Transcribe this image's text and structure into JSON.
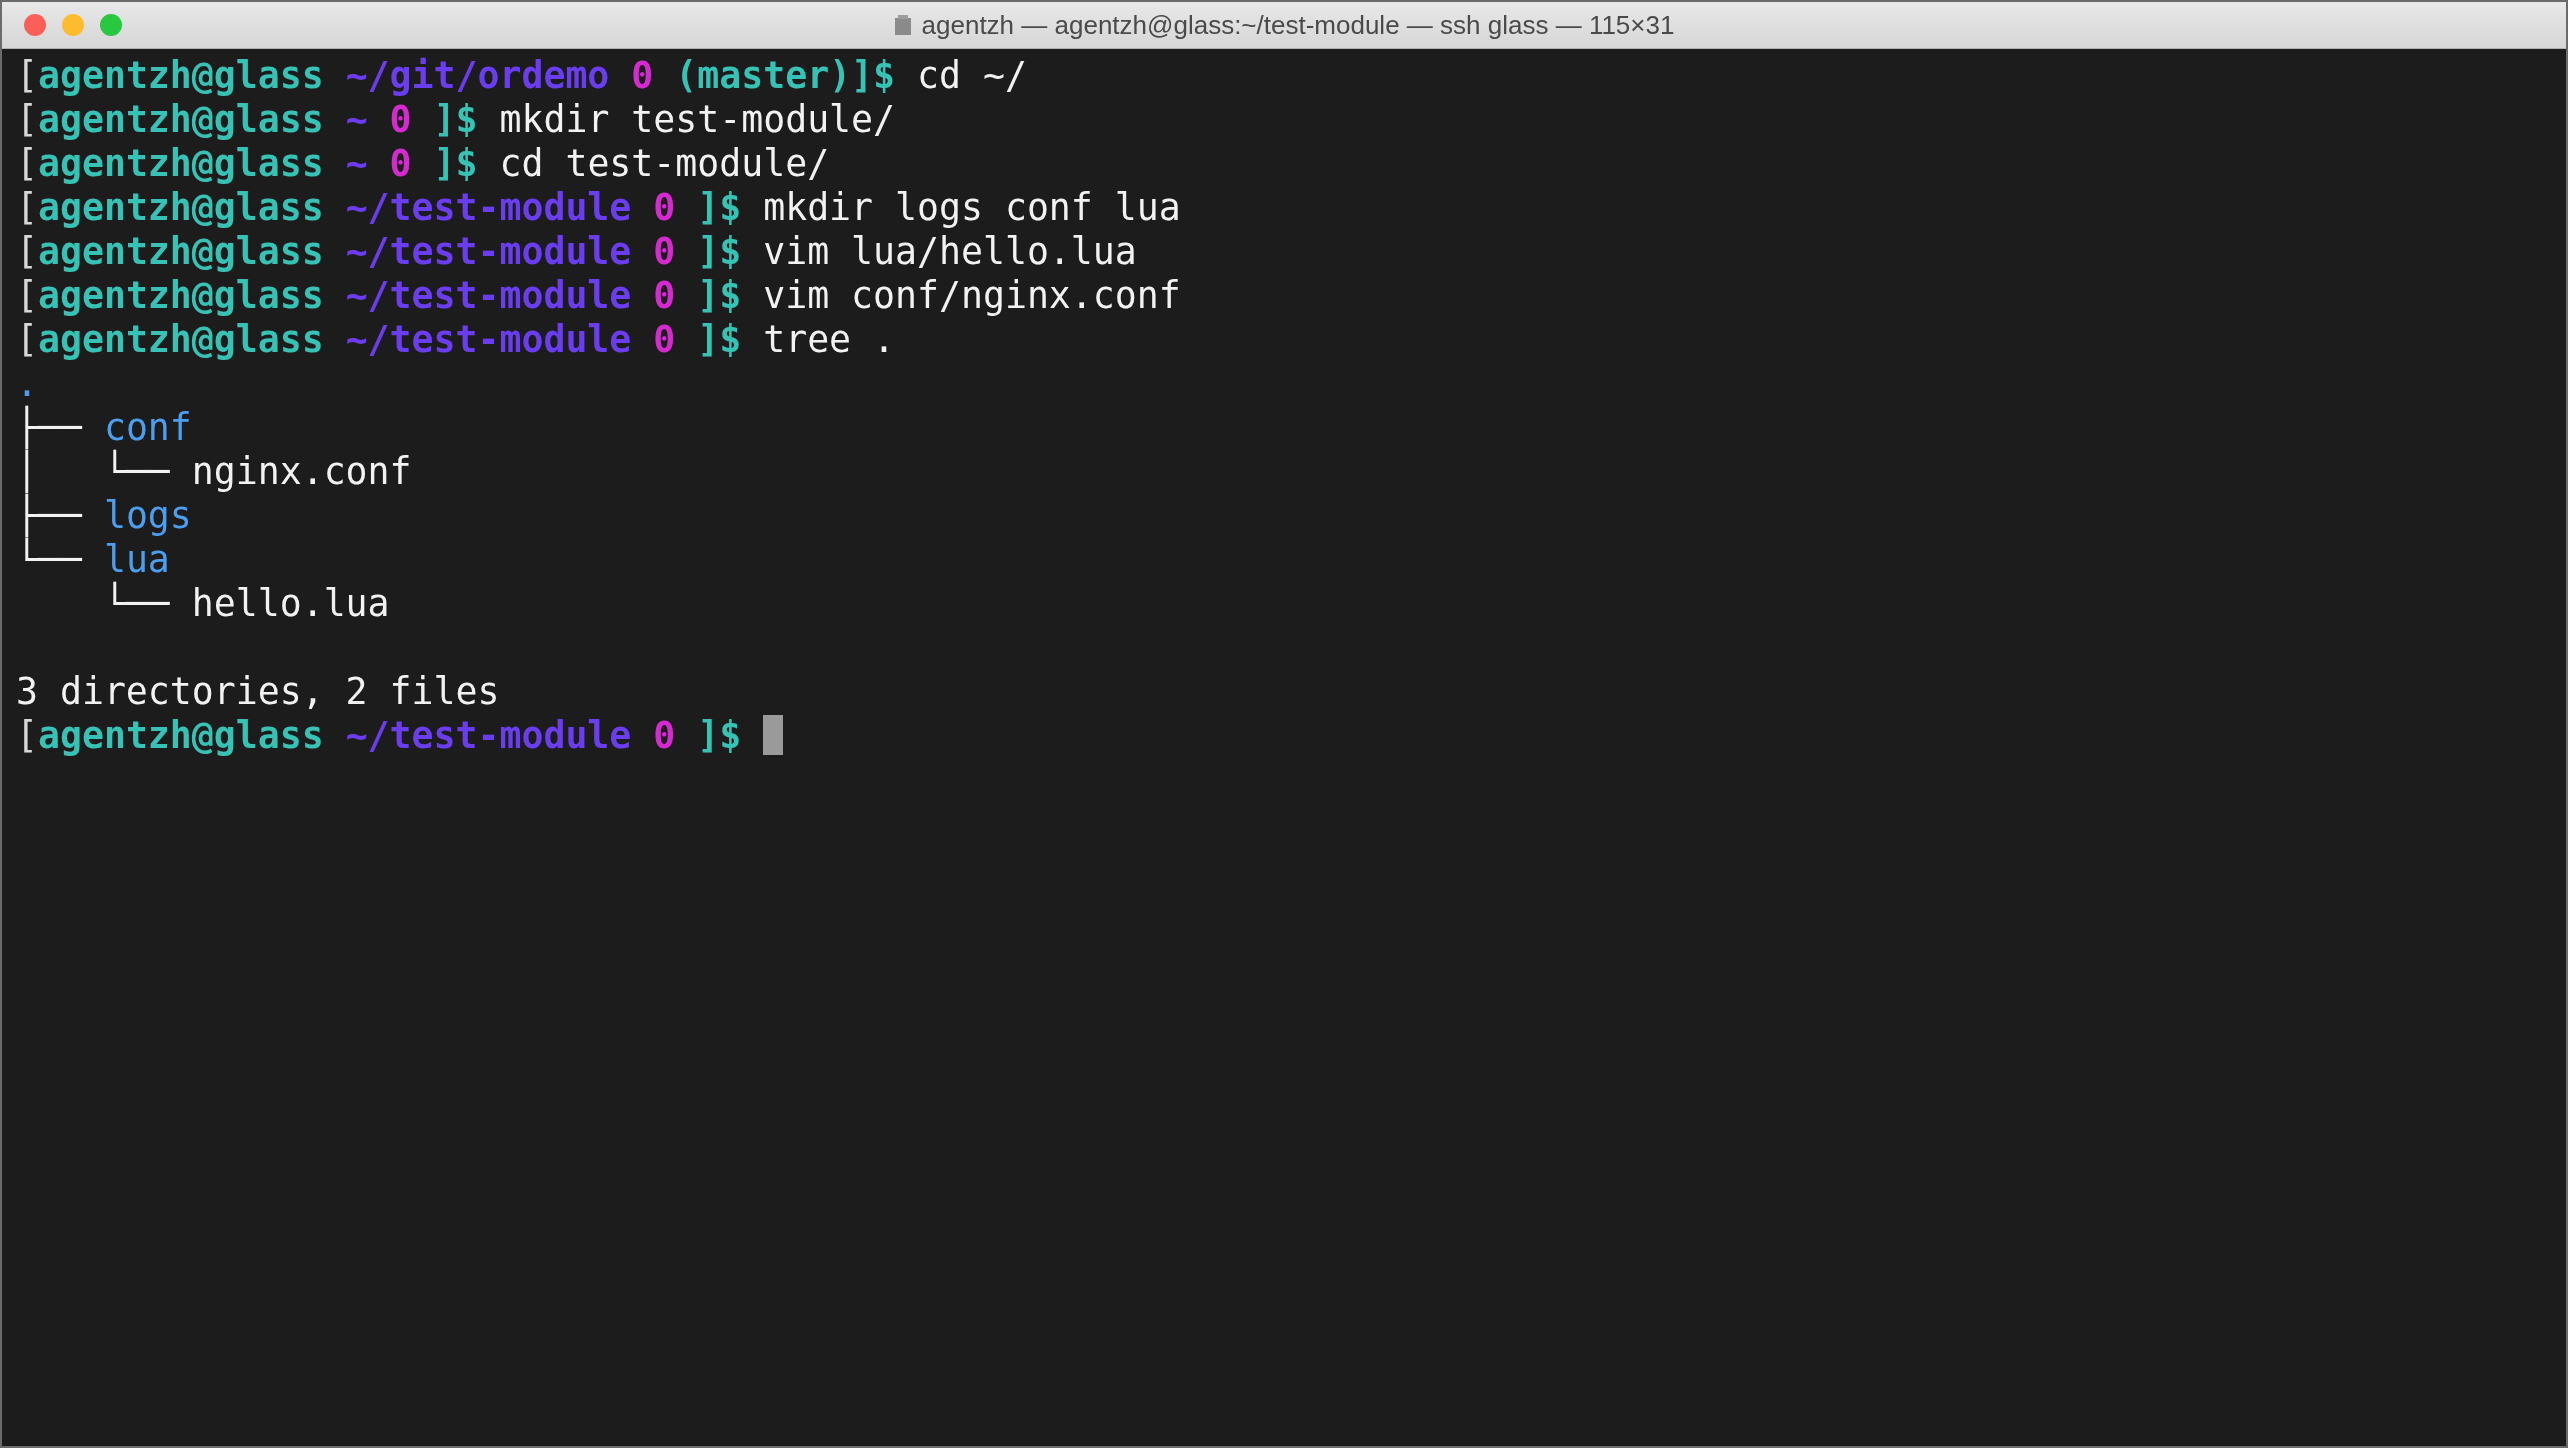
{
  "window": {
    "title": "agentzh — agentzh@glass:~/test-module — ssh glass — 115×31"
  },
  "lines": [
    {
      "kind": "text",
      "segments": [
        {
          "kind": "bracket",
          "text": "["
        },
        {
          "kind": "user",
          "text": "agentzh@glass"
        },
        {
          "kind": "path",
          "text": " ~/git/ordemo"
        },
        {
          "kind": "status",
          "text": " 0"
        },
        {
          "kind": "branch",
          "text": " (master)"
        },
        {
          "kind": "dollar",
          "text": "]$"
        },
        {
          "kind": "command",
          "text": " cd ~/"
        }
      ]
    },
    {
      "kind": "text",
      "segments": [
        {
          "kind": "bracket",
          "text": "["
        },
        {
          "kind": "user",
          "text": "agentzh@glass"
        },
        {
          "kind": "path",
          "text": " ~"
        },
        {
          "kind": "status",
          "text": " 0"
        },
        {
          "kind": "dollar",
          "text": " ]$"
        },
        {
          "kind": "command",
          "text": " mkdir test-module/"
        }
      ]
    },
    {
      "kind": "text",
      "segments": [
        {
          "kind": "bracket",
          "text": "["
        },
        {
          "kind": "user",
          "text": "agentzh@glass"
        },
        {
          "kind": "path",
          "text": " ~"
        },
        {
          "kind": "status",
          "text": " 0"
        },
        {
          "kind": "dollar",
          "text": " ]$"
        },
        {
          "kind": "command",
          "text": " cd test-module/"
        }
      ]
    },
    {
      "kind": "text",
      "segments": [
        {
          "kind": "bracket",
          "text": "["
        },
        {
          "kind": "user",
          "text": "agentzh@glass"
        },
        {
          "kind": "path",
          "text": " ~/test-module"
        },
        {
          "kind": "status",
          "text": " 0"
        },
        {
          "kind": "dollar",
          "text": " ]$"
        },
        {
          "kind": "command",
          "text": " mkdir logs conf lua"
        }
      ]
    },
    {
      "kind": "text",
      "segments": [
        {
          "kind": "bracket",
          "text": "["
        },
        {
          "kind": "user",
          "text": "agentzh@glass"
        },
        {
          "kind": "path",
          "text": " ~/test-module"
        },
        {
          "kind": "status",
          "text": " 0"
        },
        {
          "kind": "dollar",
          "text": " ]$"
        },
        {
          "kind": "command",
          "text": " vim lua/hello.lua"
        }
      ]
    },
    {
      "kind": "text",
      "segments": [
        {
          "kind": "bracket",
          "text": "["
        },
        {
          "kind": "user",
          "text": "agentzh@glass"
        },
        {
          "kind": "path",
          "text": " ~/test-module"
        },
        {
          "kind": "status",
          "text": " 0"
        },
        {
          "kind": "dollar",
          "text": " ]$"
        },
        {
          "kind": "command",
          "text": " vim conf/nginx.conf"
        }
      ]
    },
    {
      "kind": "text",
      "segments": [
        {
          "kind": "bracket",
          "text": "["
        },
        {
          "kind": "user",
          "text": "agentzh@glass"
        },
        {
          "kind": "path",
          "text": " ~/test-module"
        },
        {
          "kind": "status",
          "text": " 0"
        },
        {
          "kind": "dollar",
          "text": " ]$"
        },
        {
          "kind": "command",
          "text": " tree ."
        }
      ]
    },
    {
      "kind": "text",
      "segments": [
        {
          "kind": "dir",
          "text": "."
        }
      ]
    },
    {
      "kind": "text",
      "segments": [
        {
          "kind": "plain",
          "text": "├── "
        },
        {
          "kind": "dir",
          "text": "conf"
        }
      ]
    },
    {
      "kind": "text",
      "segments": [
        {
          "kind": "plain",
          "text": "│   └── nginx.conf"
        }
      ]
    },
    {
      "kind": "text",
      "segments": [
        {
          "kind": "plain",
          "text": "├── "
        },
        {
          "kind": "dir",
          "text": "logs"
        }
      ]
    },
    {
      "kind": "text",
      "segments": [
        {
          "kind": "plain",
          "text": "└── "
        },
        {
          "kind": "dir",
          "text": "lua"
        }
      ]
    },
    {
      "kind": "text",
      "segments": [
        {
          "kind": "plain",
          "text": "    └── hello.lua"
        }
      ]
    },
    {
      "kind": "blank"
    },
    {
      "kind": "text",
      "segments": [
        {
          "kind": "plain",
          "text": "3 directories, 2 files"
        }
      ]
    },
    {
      "kind": "text",
      "cursor": true,
      "segments": [
        {
          "kind": "bracket",
          "text": "["
        },
        {
          "kind": "user",
          "text": "agentzh@glass"
        },
        {
          "kind": "path",
          "text": " ~/test-module"
        },
        {
          "kind": "status",
          "text": " 0"
        },
        {
          "kind": "dollar",
          "text": " ]$"
        }
      ]
    }
  ]
}
